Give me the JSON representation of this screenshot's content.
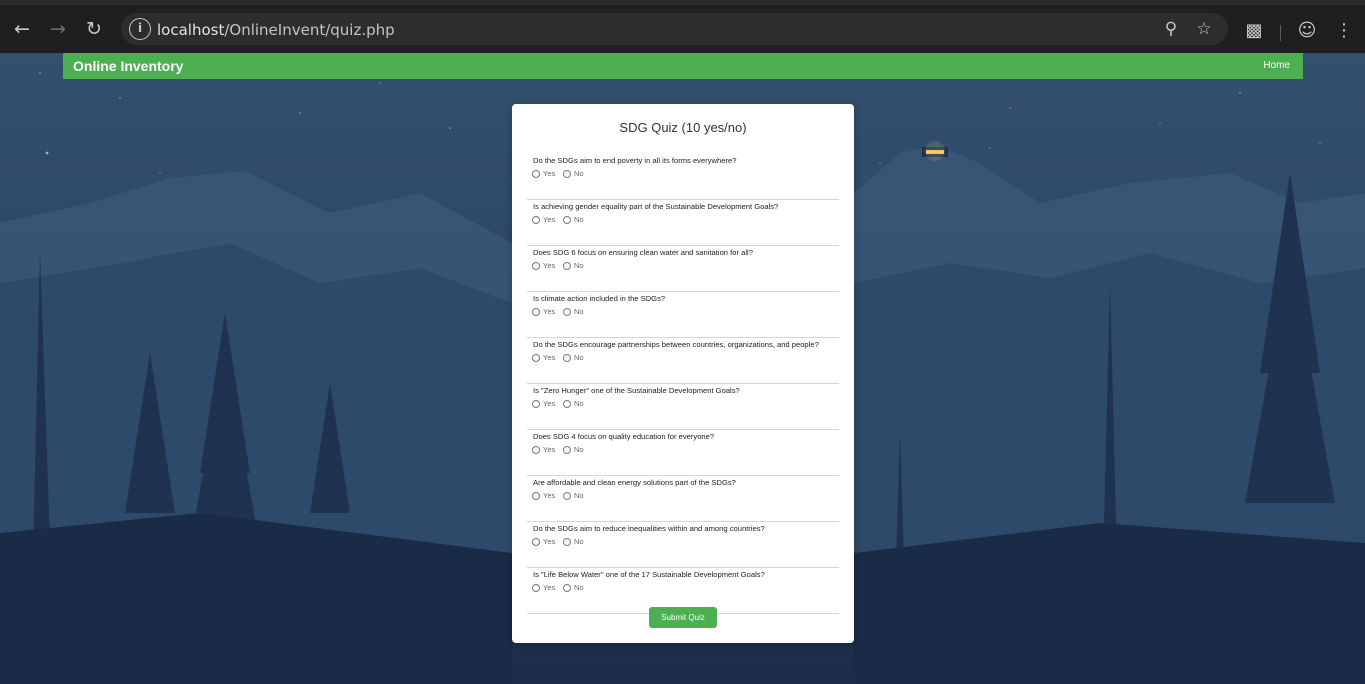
{
  "browser": {
    "url_host": "localhost",
    "url_path": "/OnlineInvent/quiz.php"
  },
  "navbar": {
    "brand": "Online Inventory",
    "home": "Home"
  },
  "quiz": {
    "title": "SDG Quiz (10 yes/no)",
    "yes_label": "Yes",
    "no_label": "No",
    "questions": [
      "Do the SDGs aim to end poverty in all its forms everywhere?",
      "Is achieving gender equality part of the Sustainable Development Goals?",
      "Does SDG 6 focus on ensuring clean water and sanitation for all?",
      "Is climate action included in the SDGs?",
      "Do the SDGs encourage partnerships between countries, organizations, and people?",
      "Is \"Zero Hunger\" one of the Sustainable Development Goals?",
      "Does SDG 4 focus on quality education for everyone?",
      "Are affordable and clean energy solutions part of the SDGs?",
      "Do the SDGs aim to reduce inequalities within and among countries?",
      "Is \"Life Below Water\" one of the 17 Sustainable Development Goals?"
    ],
    "submit_label": "Submit Quiz"
  },
  "colors": {
    "accent": "#4caf50",
    "chrome": "#1f1f1f"
  }
}
